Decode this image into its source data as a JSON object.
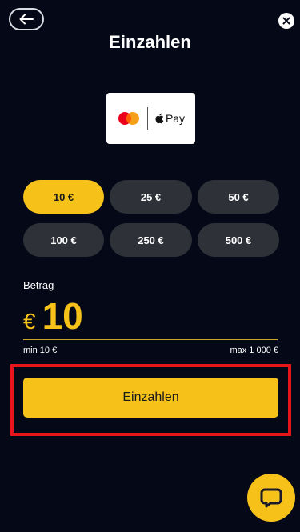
{
  "header": {
    "title": "Einzahlen",
    "back_icon": "arrow-left-icon",
    "close_icon": "close-icon"
  },
  "payment_method": {
    "logos": [
      "mastercard-logo",
      "apple-pay-logo"
    ],
    "apple_pay_label": "Pay"
  },
  "amount_options": [
    {
      "label": "10 €",
      "selected": true
    },
    {
      "label": "25 €",
      "selected": false
    },
    {
      "label": "50 €",
      "selected": false
    },
    {
      "label": "100 €",
      "selected": false
    },
    {
      "label": "250 €",
      "selected": false
    },
    {
      "label": "500 €",
      "selected": false
    }
  ],
  "amount": {
    "label": "Betrag",
    "currency_symbol": "€",
    "value": "10",
    "min_label": "min 10 €",
    "max_label": "max 1 000 €"
  },
  "submit": {
    "label": "Einzahlen"
  },
  "chat": {
    "icon": "chat-bubble-icon"
  },
  "colors": {
    "background": "#050816",
    "accent": "#f6c21a",
    "button_inactive": "#2f3139",
    "highlight": "#e8141c"
  }
}
